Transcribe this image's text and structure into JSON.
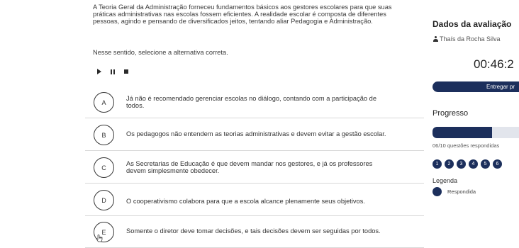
{
  "question": {
    "statement_lines": [
      "A Teoria Geral da Administração forneceu fundamentos básicos aos gestores escolares para que suas",
      "práticas administrativas nas escolas fossem eficientes. A realidade escolar é composta de diferentes",
      "pessoas, agindo e pensando de diversificados jeitos, tentando aliar Pedagogia e Administração."
    ],
    "instruction": "Nesse sentido, selecione a alternativa correta."
  },
  "media": {
    "play_icon": "play-icon",
    "pause_icon": "pause-icon",
    "stop_icon": "stop-icon"
  },
  "options": [
    {
      "letter": "A",
      "lines": [
        "Já não é recomendado gerenciar escolas no diálogo, contando com a participação de",
        "todos."
      ]
    },
    {
      "letter": "B",
      "lines": [
        "Os pedagogos não entendem as teorias administrativas e devem evitar a gestão escolar."
      ]
    },
    {
      "letter": "C",
      "lines": [
        "As Secretarias de Educação é que devem mandar nos gestores, e já os professores",
        "devem simplesmente obedecer."
      ]
    },
    {
      "letter": "D",
      "lines": [
        "O cooperativismo colabora para que a escola alcance plenamente seus objetivos."
      ]
    },
    {
      "letter": "E",
      "lines": [
        "Somente o diretor deve tomar decisões, e tais decisões devem ser seguidas por todos."
      ]
    }
  ],
  "sidebar": {
    "title": "Dados da avaliação",
    "user_icon": "user-icon",
    "user_name": "Thaís da Rocha Silva",
    "timer": "00:46:2",
    "submit_label": "Entregar pr",
    "progress_title": "Progresso",
    "progress_fraction": 0.6,
    "progress_caption": "06/10 questões respondidas",
    "question_numbers": [
      "1",
      "2",
      "3",
      "4",
      "5",
      "6"
    ],
    "legend_title": "Legenda",
    "legend_answered": "Respondida"
  },
  "colors": {
    "accent": "#1c2f5c",
    "track": "#e2e5ec",
    "divider": "#d8d8d8"
  }
}
